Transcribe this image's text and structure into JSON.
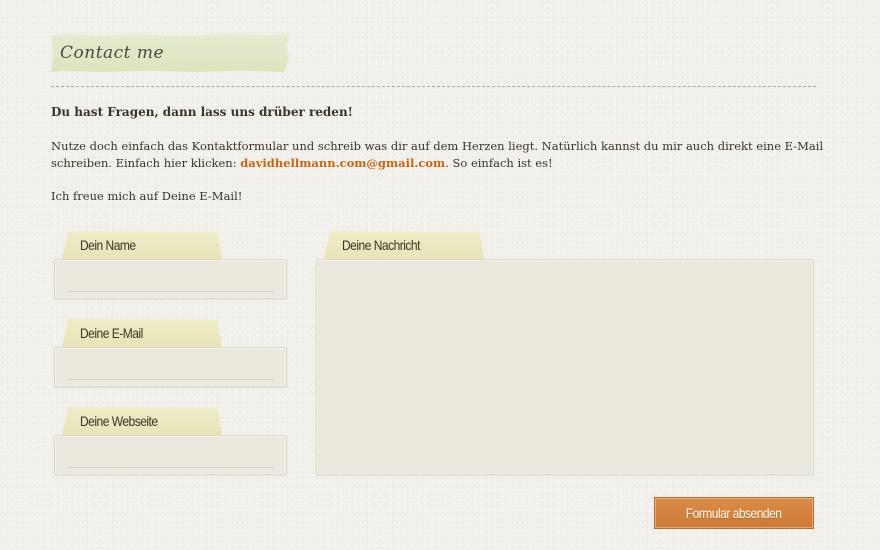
{
  "header": {
    "title": "Contact me"
  },
  "intro": {
    "lead": "Du hast Fragen, dann lass uns drüber reden!",
    "paragraph_before": "Nutze doch einfach das Kontaktformular und schreib was dir auf dem Herzen liegt. Natürlich kannst du mir auch direkt eine E-Mail schreiben. Einfach hier klicken: ",
    "email": "davidhellmann.com@gmail.com",
    "paragraph_after": ". So einfach ist es!",
    "thanks": "Ich freue mich auf Deine E-Mail!"
  },
  "form": {
    "name_label": "Dein Name",
    "name_value": "",
    "email_label": "Deine E-Mail",
    "email_value": "",
    "website_label": "Deine Webseite",
    "website_value": "",
    "message_label": "Deine Nachricht",
    "message_value": "",
    "submit_label": "Formular absenden"
  },
  "colors": {
    "accent": "#cd7a36",
    "link": "#c86414",
    "tape": "#e8e4b7",
    "title_tape": "#dbe4bd"
  }
}
